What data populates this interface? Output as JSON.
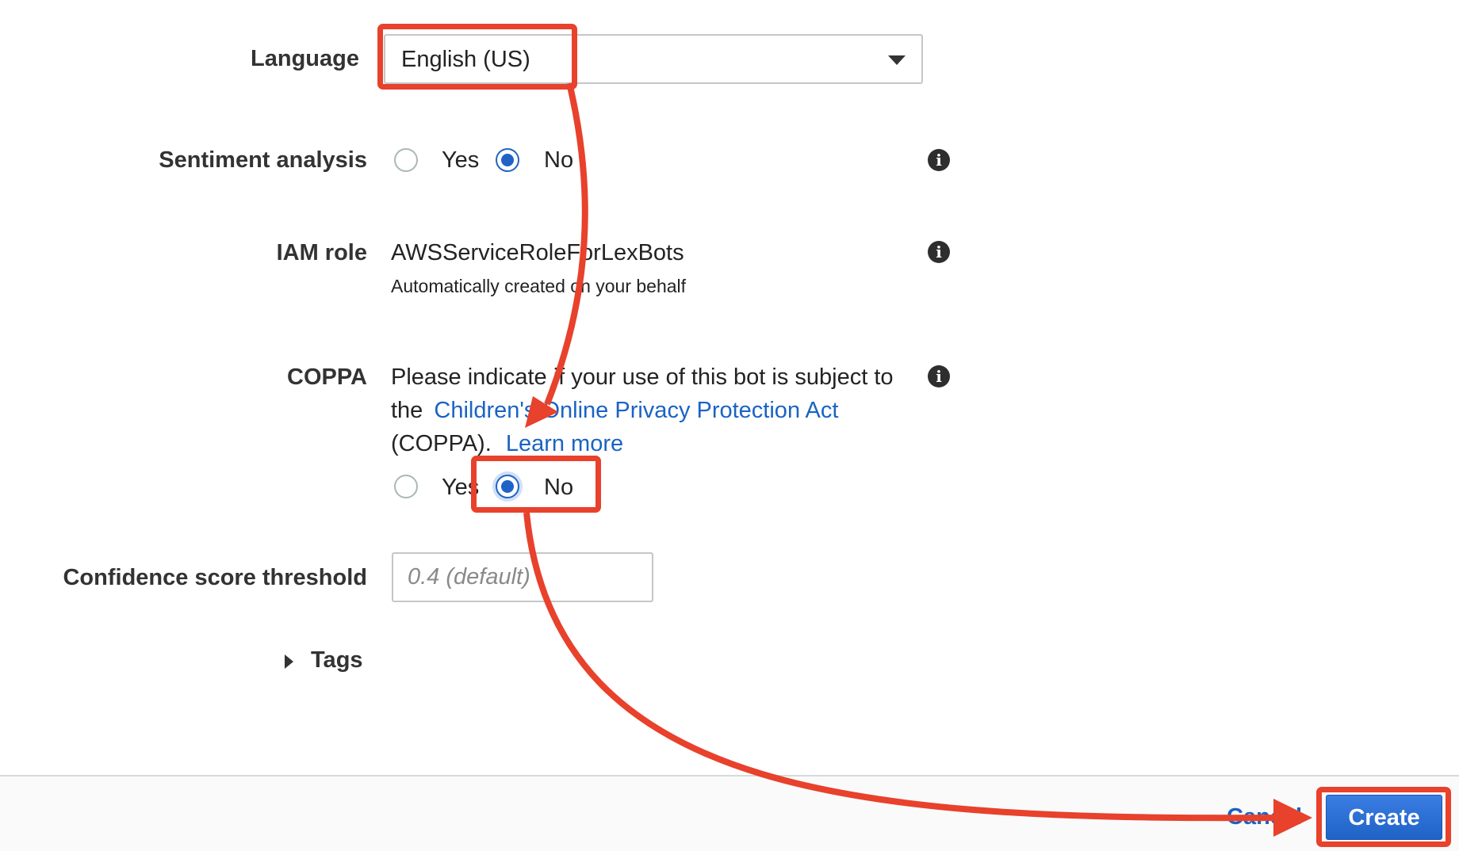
{
  "language": {
    "label": "Language",
    "selected": "English (US)"
  },
  "sentiment": {
    "label": "Sentiment analysis",
    "yes": "Yes",
    "no": "No",
    "selected": "No"
  },
  "iam": {
    "label": "IAM role",
    "value": "AWSServiceRoleForLexBots",
    "sub": "Automatically created on your behalf"
  },
  "coppa": {
    "label": "COPPA",
    "text1": "Please indicate if your use of this bot is subject to",
    "text2_prefix": "the",
    "link": "Children's Online Privacy Protection Act",
    "text3": "(COPPA).",
    "learn_more": "Learn more",
    "yes": "Yes",
    "no": "No",
    "selected": "No"
  },
  "confidence": {
    "label": "Confidence score threshold",
    "placeholder": "0.4 (default)"
  },
  "tags": {
    "label": "Tags"
  },
  "footer": {
    "cancel": "Cancel",
    "create": "Create"
  },
  "colors": {
    "accent": "#1f63c7",
    "annotation": "#e8412c",
    "link": "#1a63c4"
  },
  "icons": [
    "caret-down-icon",
    "info-icon",
    "caret-right-icon",
    "arrow-annotation"
  ]
}
